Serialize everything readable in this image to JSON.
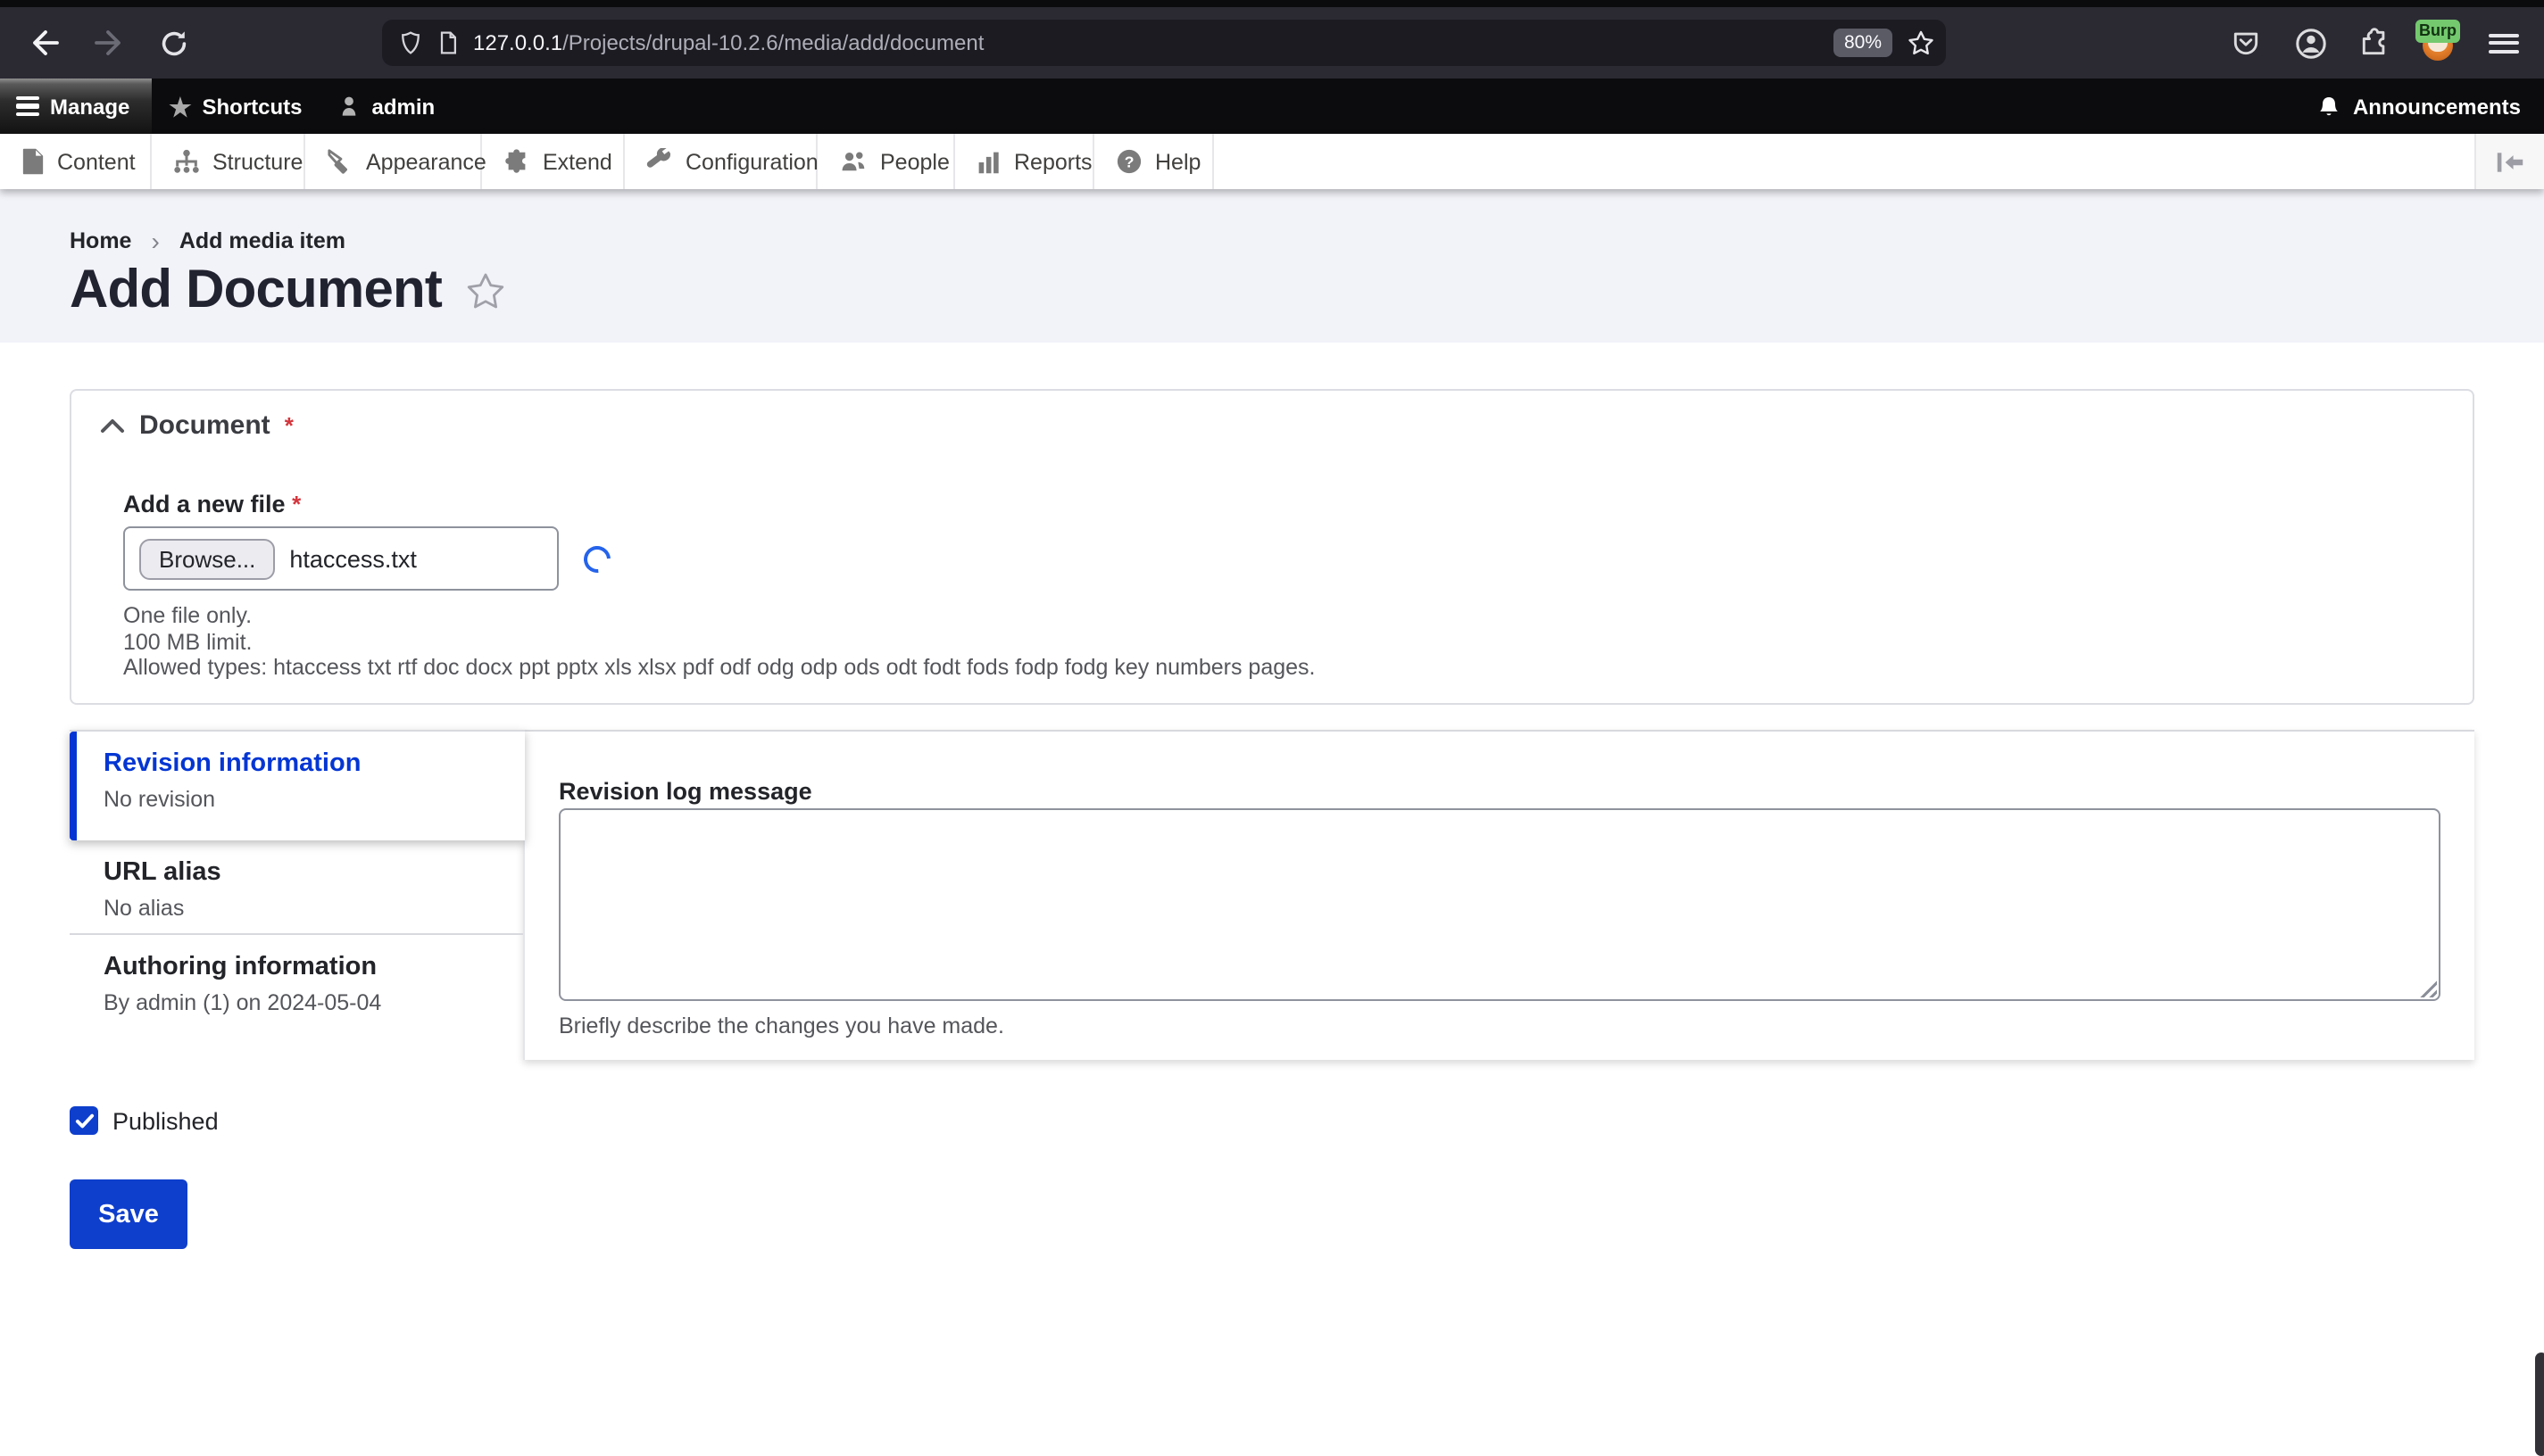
{
  "browser": {
    "url_domain": "127.0.0.1",
    "url_path": "/Projects/drupal-10.2.6/media/add/document",
    "zoom_level": "80%",
    "extension_badge": "Burp"
  },
  "admin_toolbar": {
    "manage_label": "Manage",
    "shortcuts_label": "Shortcuts",
    "user_label": "admin",
    "announcements_label": "Announcements"
  },
  "admin_menu": {
    "items": [
      {
        "label": "Content",
        "icon": "file-icon"
      },
      {
        "label": "Structure",
        "icon": "sitemap-icon"
      },
      {
        "label": "Appearance",
        "icon": "brush-icon"
      },
      {
        "label": "Extend",
        "icon": "puzzle-icon"
      },
      {
        "label": "Configuration",
        "icon": "wrench-icon"
      },
      {
        "label": "People",
        "icon": "users-icon"
      },
      {
        "label": "Reports",
        "icon": "bar-chart-icon"
      },
      {
        "label": "Help",
        "icon": "question-icon"
      }
    ]
  },
  "breadcrumb": {
    "home_label": "Home",
    "current_label": "Add media item"
  },
  "page": {
    "title": "Add Document"
  },
  "document_fieldset": {
    "legend": "Document",
    "required_mark": "*",
    "file_field_label": "Add a new file",
    "browse_button_label": "Browse...",
    "file_name": "htaccess.txt",
    "help_lines": [
      "One file only.",
      "100 MB limit.",
      "Allowed types: htaccess txt rtf doc docx ppt pptx xls xlsx pdf odf odg odp ods odt fodt fods fodp fodg key numbers pages."
    ]
  },
  "vertical_tabs": {
    "tabs": [
      {
        "title": "Revision information",
        "summary": "No revision",
        "active": true
      },
      {
        "title": "URL alias",
        "summary": "No alias",
        "active": false
      },
      {
        "title": "Authoring information",
        "summary": "By admin (1) on 2024-05-04",
        "active": false
      }
    ]
  },
  "revision_pane": {
    "label": "Revision log message",
    "textarea_value": "",
    "description": "Briefly describe the changes you have made."
  },
  "actions": {
    "published_label": "Published",
    "published_checked": true,
    "save_label": "Save"
  },
  "colors": {
    "primary_blue": "#0e3ecc",
    "active_tab_blue": "#0336d3",
    "required_red": "#d4353c",
    "header_bg": "#f2f3f9",
    "chrome_bg": "#2b2a33",
    "admin_toolbar_bg": "#0c0c0e",
    "badge_green": "#74c96e"
  }
}
